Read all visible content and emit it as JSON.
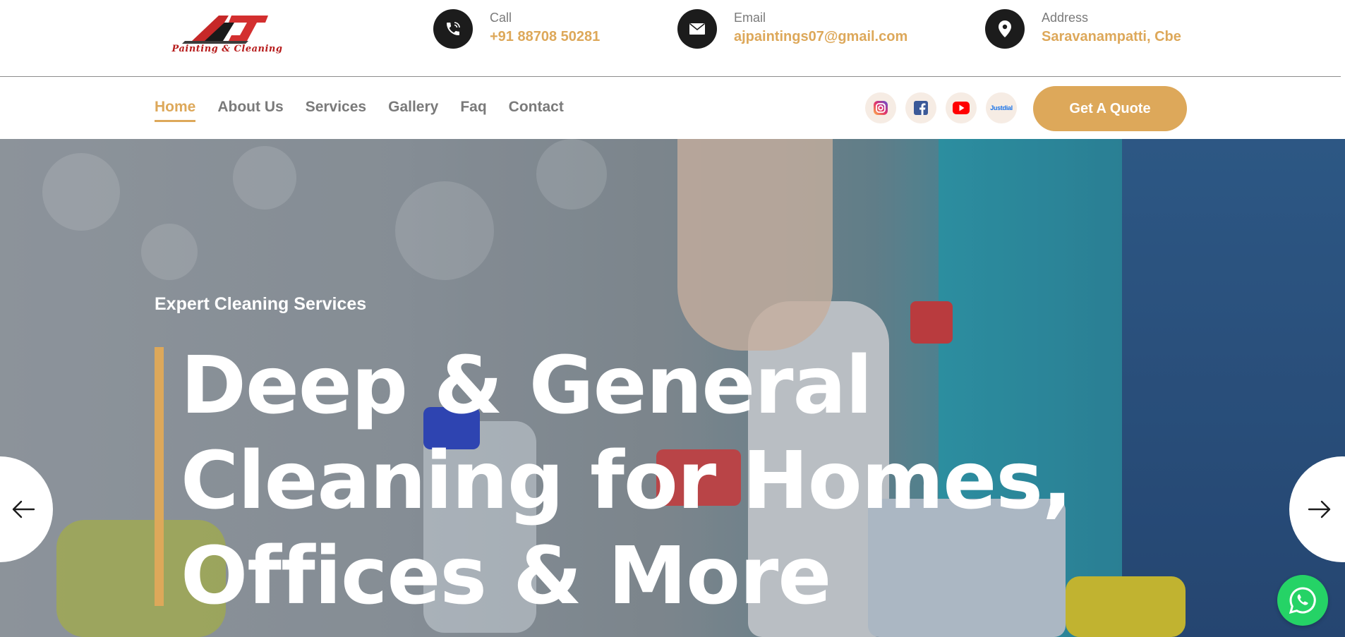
{
  "brand": {
    "logo_initials": "AJ",
    "logo_tagline": "Painting & Cleaning"
  },
  "contact": {
    "call": {
      "label": "Call",
      "value": "+91 88708 50281",
      "icon": "phone-icon"
    },
    "email": {
      "label": "Email",
      "value": "ajpaintings07@gmail.com",
      "icon": "mail-icon"
    },
    "address": {
      "label": "Address",
      "value": "Saravanampatti, Cbe",
      "icon": "location-pin-icon"
    }
  },
  "nav": {
    "items": [
      {
        "label": "Home",
        "active": true
      },
      {
        "label": "About Us",
        "active": false
      },
      {
        "label": "Services",
        "active": false
      },
      {
        "label": "Gallery",
        "active": false
      },
      {
        "label": "Faq",
        "active": false
      },
      {
        "label": "Contact",
        "active": false
      }
    ],
    "socials": [
      "instagram-icon",
      "facebook-icon",
      "youtube-icon",
      "justdial-icon"
    ],
    "justdial_text": "Justdial",
    "quote_button": "Get A Quote"
  },
  "hero": {
    "subtitle": "Expert Cleaning Services",
    "title_lines": [
      "Deep & General",
      "Cleaning for Homes,",
      "Offices & More"
    ],
    "prev_icon": "arrow-left-icon",
    "next_icon": "arrow-right-icon"
  },
  "floating": {
    "whatsapp_icon": "whatsapp-icon"
  },
  "colors": {
    "accent": "#dda85a",
    "dark_icon_bg": "#1c1c1c",
    "nav_text": "#7a7a7a",
    "whatsapp": "#25d366"
  }
}
